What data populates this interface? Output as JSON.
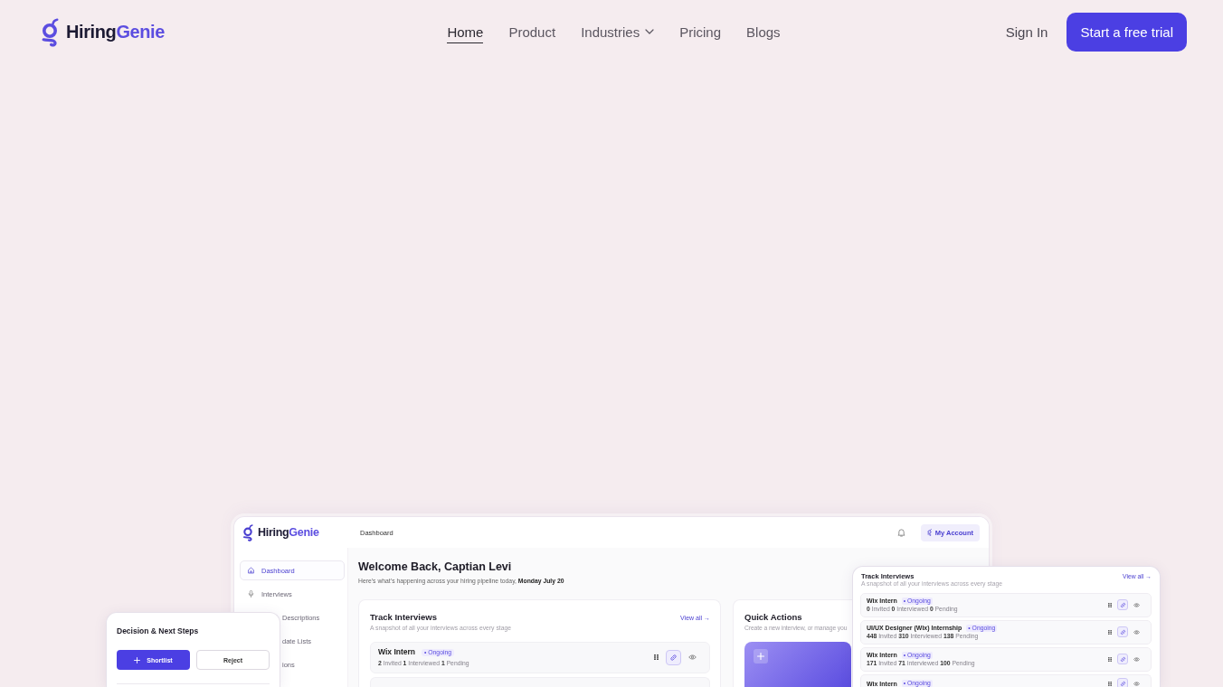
{
  "header": {
    "logo": {
      "wordmark": [
        "Hiring",
        "Genie"
      ]
    },
    "nav": [
      {
        "label": "Home",
        "selected": true,
        "kind": "link"
      },
      {
        "label": "Product",
        "selected": false,
        "kind": "link"
      },
      {
        "label": "Industries",
        "selected": false,
        "kind": "dropdown"
      },
      {
        "label": "Pricing",
        "selected": false,
        "kind": "link"
      },
      {
        "label": "Blogs",
        "selected": false,
        "kind": "link"
      }
    ],
    "sign_in": "Sign In",
    "cta": "Start a free trial"
  },
  "dashboard": {
    "logo": {
      "wordmark": [
        "Hiring",
        "Genie"
      ]
    },
    "page_title": "Dashboard",
    "account_button": "My Account",
    "sidebar": {
      "items": [
        {
          "label": "Dashboard",
          "selected": true,
          "covered": false
        },
        {
          "label": "Interviews",
          "selected": false,
          "covered": false
        },
        {
          "label": "Descriptions",
          "selected": false,
          "covered": true
        },
        {
          "label": "date Lists",
          "selected": false,
          "covered": true
        },
        {
          "label": "ions",
          "selected": false,
          "covered": true
        }
      ]
    },
    "welcome": {
      "title": "Welcome Back, Captian Levi",
      "subtitle": "Here’s what’s happening across your hiring pipeline today, **Monday July 20**"
    },
    "track_interviews": {
      "title": "Track Interviews",
      "link": "View all →",
      "subtitle": "A snapshot of all your interviews across every stage",
      "rows": [
        {
          "title": "Wix Intern",
          "status": "• Ongoing",
          "stats": "**2** Invited **1** Interviewed **1** Pending"
        }
      ]
    },
    "quick_actions": {
      "title": "Quick Actions",
      "subtitle": "Create a new interview, or manage you"
    }
  },
  "decision_card": {
    "title": "Decision & Next Steps",
    "buttons": [
      {
        "label": "Shortlist",
        "kind": "primary"
      },
      {
        "label": "Reject",
        "kind": "secondary"
      }
    ]
  },
  "interviews_card": {
    "title": "Track Interviews",
    "link": "View all →",
    "subtitle": "A snapshot of all your interviews across every stage",
    "rows": [
      {
        "title": "Wix Intern",
        "status": "• Ongoing",
        "stats": "**0** Invited **0** Interviewed **0** Pending"
      },
      {
        "title": "UI/UX Designer (Wix) Internship",
        "status": "• Ongoing",
        "stats": "**448** Invited **310** Interviewed **138** Pending"
      },
      {
        "title": "Wix Intern",
        "status": "• Ongoing",
        "stats": "**171** Invited **71** Interviewed **100** Pending"
      },
      {
        "title": "Wix Intern",
        "status": "• Ongoing"
      }
    ]
  }
}
